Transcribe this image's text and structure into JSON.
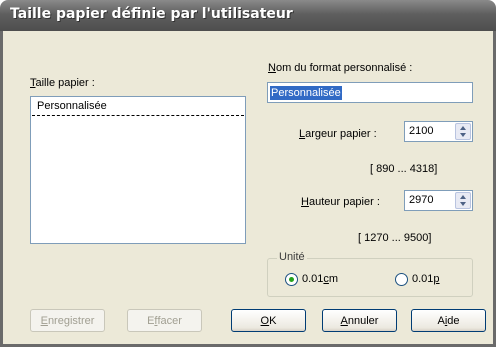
{
  "window": {
    "title": "Taille papier définie par l'utilisateur"
  },
  "paper_size": {
    "label_key": "T",
    "label_rest": "aille papier :",
    "items": [
      "Personnalisée"
    ]
  },
  "custom_name": {
    "label_key": "N",
    "label_rest": "om du format personnalisé :",
    "value": "Personnalisée"
  },
  "width": {
    "label_key": "L",
    "label_rest": "argeur papier  :",
    "value": "2100",
    "range": "[  890 ...  4318]"
  },
  "height": {
    "label_key": "H",
    "label_rest": "auteur papier :",
    "value": "2970",
    "range": "[ 1270 ...  9500]"
  },
  "unit": {
    "legend": "Unité",
    "options": [
      {
        "pre": "0.01",
        "key": "c",
        "post": "m",
        "selected": true
      },
      {
        "pre": "0.01",
        "key": "p",
        "post": "",
        "selected": false
      }
    ]
  },
  "buttons": {
    "save": {
      "key": "E",
      "rest": "nregistrer",
      "enabled": false
    },
    "delete": {
      "pre": "E",
      "key": "f",
      "rest": "facer",
      "enabled": false
    },
    "ok": {
      "key": "O",
      "rest": "K"
    },
    "cancel": {
      "key": "A",
      "rest": "nnuler"
    },
    "help": {
      "pre": "A",
      "key": "i",
      "rest": "de"
    }
  }
}
